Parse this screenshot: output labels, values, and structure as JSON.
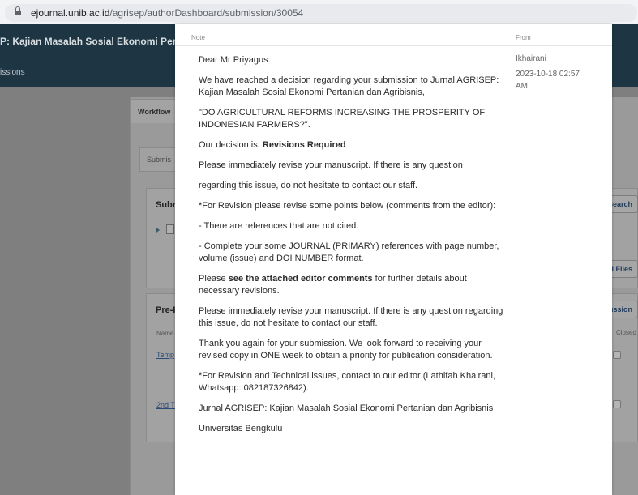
{
  "browser": {
    "host": "ejournal.unib.ac.id",
    "path": "/agrisep/authorDashboard/submission/30054"
  },
  "site": {
    "title": "P: Kajian Masalah Sosial Ekonomi Pertan",
    "nav": "issions"
  },
  "workflow": {
    "tab": "Workflow",
    "subtab": "Submis",
    "card1_title": "Subr",
    "card2_title": "Pre-I",
    "col_name": "Name",
    "link1": "Temp",
    "link2": "2nd T",
    "search_button": ", Search",
    "files_button": "All Files",
    "discussion_button": "scussion",
    "closed_label": "Closed"
  },
  "note": {
    "column_note": "Note",
    "column_from": "From",
    "from_name": "Ikhairani",
    "from_date": "2023-10-18 02:57 AM",
    "paragraphs": {
      "p1": "Dear Mr Priyagus:",
      "p2": "We have reached a decision regarding your submission to Jurnal AGRISEP: Kajian Masalah Sosial Ekonomi Pertanian dan Agribisnis,",
      "p3": "\"DO AGRICULTURAL REFORMS INCREASING THE PROSPERITY OF INDONESIAN FARMERS?\".",
      "p4_prefix": "Our decision is: ",
      "p4_bold": "Revisions Required",
      "p5": "Please immediately revise your manuscript. If there is any question",
      "p6": "regarding this issue, do not hesitate to contact our staff.",
      "p7": "*For Revision please revise some points below (comments from the editor):",
      "p8": "- There are references that are not cited.",
      "p9": "- Complete your some JOURNAL (PRIMARY) references with page number, volume (issue) and DOI NUMBER format.",
      "p10_prefix": "Please ",
      "p10_bold": "see the attached editor comments",
      "p10_suffix": " for further details about necessary revisions.",
      "p11": "Please immediately revise your manuscript. If there is any question regarding this issue, do not hesitate to contact our staff.",
      "p12": "Thank you again for your submission. We look forward to receiving your revised copy in ONE week to obtain a priority for publication consideration.",
      "p13": "*For Revision and Technical issues, contact to our editor (Lathifah Khairani, Whatsapp: 082187326842).",
      "p14": "Jurnal AGRISEP: Kajian Masalah Sosial Ekonomi Pertanian dan Agribisnis",
      "p15": "Universitas Bengkulu"
    }
  }
}
